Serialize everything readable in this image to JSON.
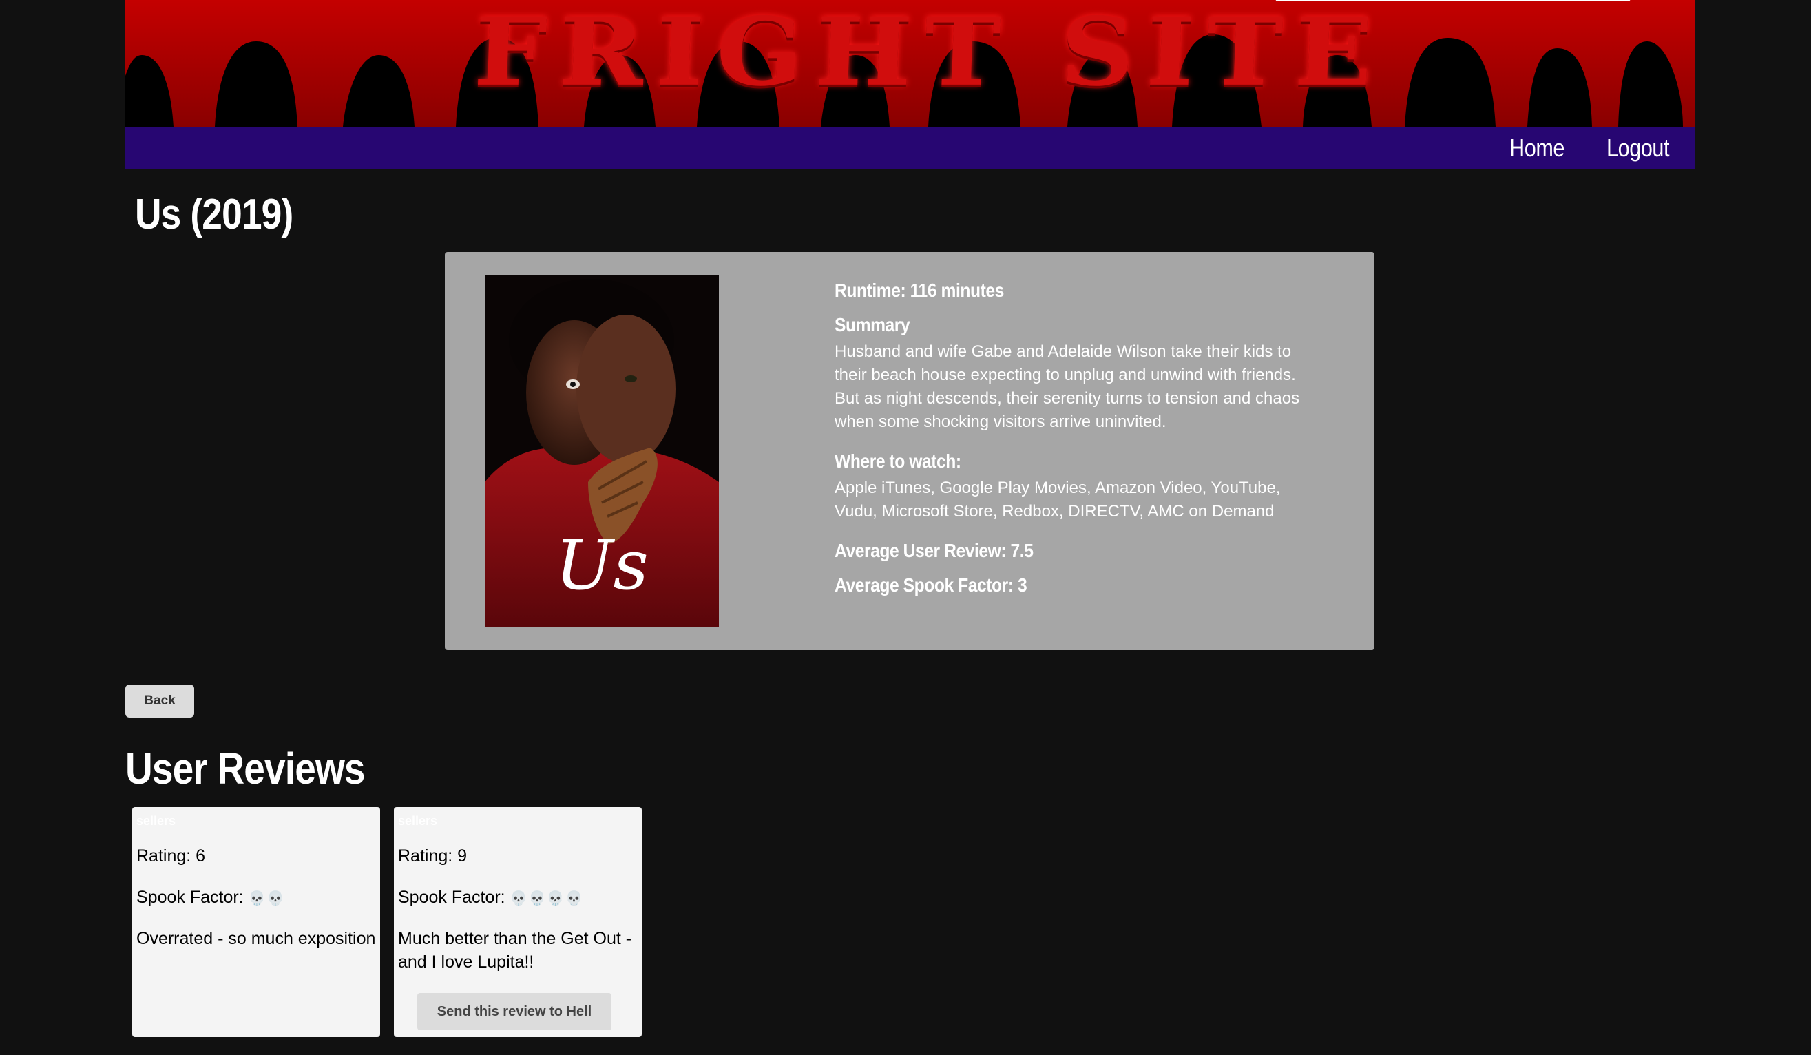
{
  "site": {
    "title": "FRIGHT SITE",
    "nav": [
      {
        "label": "Home"
      },
      {
        "label": "Logout"
      }
    ]
  },
  "colors": {
    "background": "#111111",
    "nav_bar": "#270672",
    "banner_blood": "#b00000",
    "info_card": "#a6a6a6",
    "review_card": "#f4f4f4"
  },
  "movie": {
    "title": "Us (2019)",
    "poster_text": "Us",
    "runtime": "Runtime: 116 minutes",
    "summary_label": "Summary",
    "summary": "Husband and wife Gabe and Adelaide Wilson take their kids to their beach house expecting to unplug and unwind with friends. But as night descends, their serenity turns to tension and chaos when some shocking visitors arrive uninvited.",
    "where_label": "Where to watch:",
    "where": "Apple iTunes, Google Play Movies, Amazon Video, YouTube, Vudu, Microsoft Store, Redbox, DIRECTV, AMC on Demand",
    "avg_review": "Average User Review: 7.5",
    "avg_spook": "Average Spook Factor: 3"
  },
  "actions": {
    "back": "Back"
  },
  "reviews": {
    "heading": "User Reviews",
    "items": [
      {
        "user": "sellers",
        "rating": "Rating: 6",
        "spook_label": "Spook Factor:",
        "spook_icons": "💀💀",
        "spook_count": 2,
        "text": "Overrated - so much exposition"
      },
      {
        "user": "sellers",
        "rating": "Rating: 9",
        "spook_label": "Spook Factor:",
        "spook_icons": "💀💀💀💀",
        "spook_count": 4,
        "text": "Much better than the Get Out - and I love Lupita!!",
        "button": "Send this review to Hell"
      }
    ]
  }
}
